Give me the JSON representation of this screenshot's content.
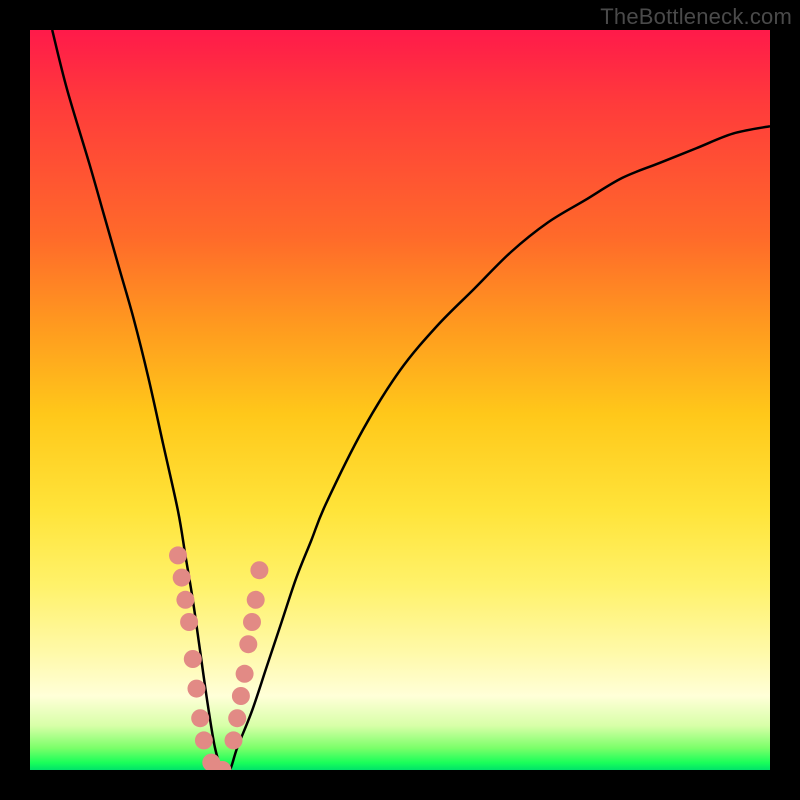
{
  "watermark": "TheBottleneck.com",
  "chart_data": {
    "type": "line",
    "title": "",
    "xlabel": "",
    "ylabel": "",
    "xlim": [
      0,
      100
    ],
    "ylim": [
      0,
      100
    ],
    "series": [
      {
        "name": "bottleneck-curve",
        "x": [
          3,
          5,
          8,
          10,
          12,
          14,
          16,
          18,
          20,
          21,
          22,
          23,
          24,
          25,
          26,
          27,
          28,
          30,
          32,
          34,
          36,
          38,
          40,
          45,
          50,
          55,
          60,
          65,
          70,
          75,
          80,
          85,
          90,
          95,
          100
        ],
        "y": [
          100,
          92,
          82,
          75,
          68,
          61,
          53,
          44,
          35,
          29,
          23,
          16,
          9,
          3,
          0,
          0,
          3,
          8,
          14,
          20,
          26,
          31,
          36,
          46,
          54,
          60,
          65,
          70,
          74,
          77,
          80,
          82,
          84,
          86,
          87
        ]
      },
      {
        "name": "scatter-points",
        "x": [
          20.0,
          20.5,
          21.0,
          21.5,
          22.0,
          22.5,
          23.0,
          23.5,
          24.5,
          25.0,
          25.5,
          26.0,
          27.5,
          28.0,
          28.5,
          29.0,
          29.5,
          30.0,
          30.5,
          31.0
        ],
        "y": [
          29,
          26,
          23,
          20,
          15,
          11,
          7,
          4,
          1,
          0,
          0,
          0,
          4,
          7,
          10,
          13,
          17,
          20,
          23,
          27
        ]
      }
    ],
    "background_gradient": {
      "stops": [
        {
          "pos": 0,
          "color": "#ff1a4a"
        },
        {
          "pos": 40,
          "color": "#ff9a1f"
        },
        {
          "pos": 75,
          "color": "#fff26a"
        },
        {
          "pos": 94,
          "color": "#d8ffa8"
        },
        {
          "pos": 100,
          "color": "#00e36a"
        }
      ]
    },
    "marker_color": "#e28a85",
    "curve_color": "#000000"
  }
}
